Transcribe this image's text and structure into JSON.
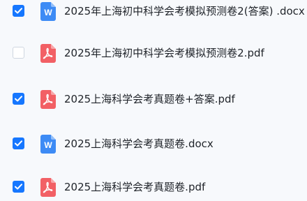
{
  "files": [
    {
      "name": "2025年上海初中科学会考模拟预测卷2(答案) .docx",
      "type": "docx",
      "checked": true,
      "icon": "word-doc-icon",
      "icon_letter": "W"
    },
    {
      "name": "2025年上海初中科学会考模拟预测卷2.pdf",
      "type": "pdf",
      "checked": false,
      "icon": "pdf-file-icon"
    },
    {
      "name": "2025上海科学会考真题卷+答案.pdf",
      "type": "pdf",
      "checked": true,
      "icon": "pdf-file-icon"
    },
    {
      "name": "2025上海科学会考真题卷.docx",
      "type": "docx",
      "checked": true,
      "icon": "word-doc-icon",
      "icon_letter": "W"
    },
    {
      "name": "2025上海科学会考真题卷.pdf",
      "type": "pdf",
      "checked": true,
      "icon": "pdf-file-icon"
    }
  ],
  "colors": {
    "checkbox_checked": "#1677ff",
    "word_icon": "#3d8bf5",
    "pdf_icon": "#f26065",
    "text": "#1f2329",
    "background": "#f7f9fc"
  }
}
